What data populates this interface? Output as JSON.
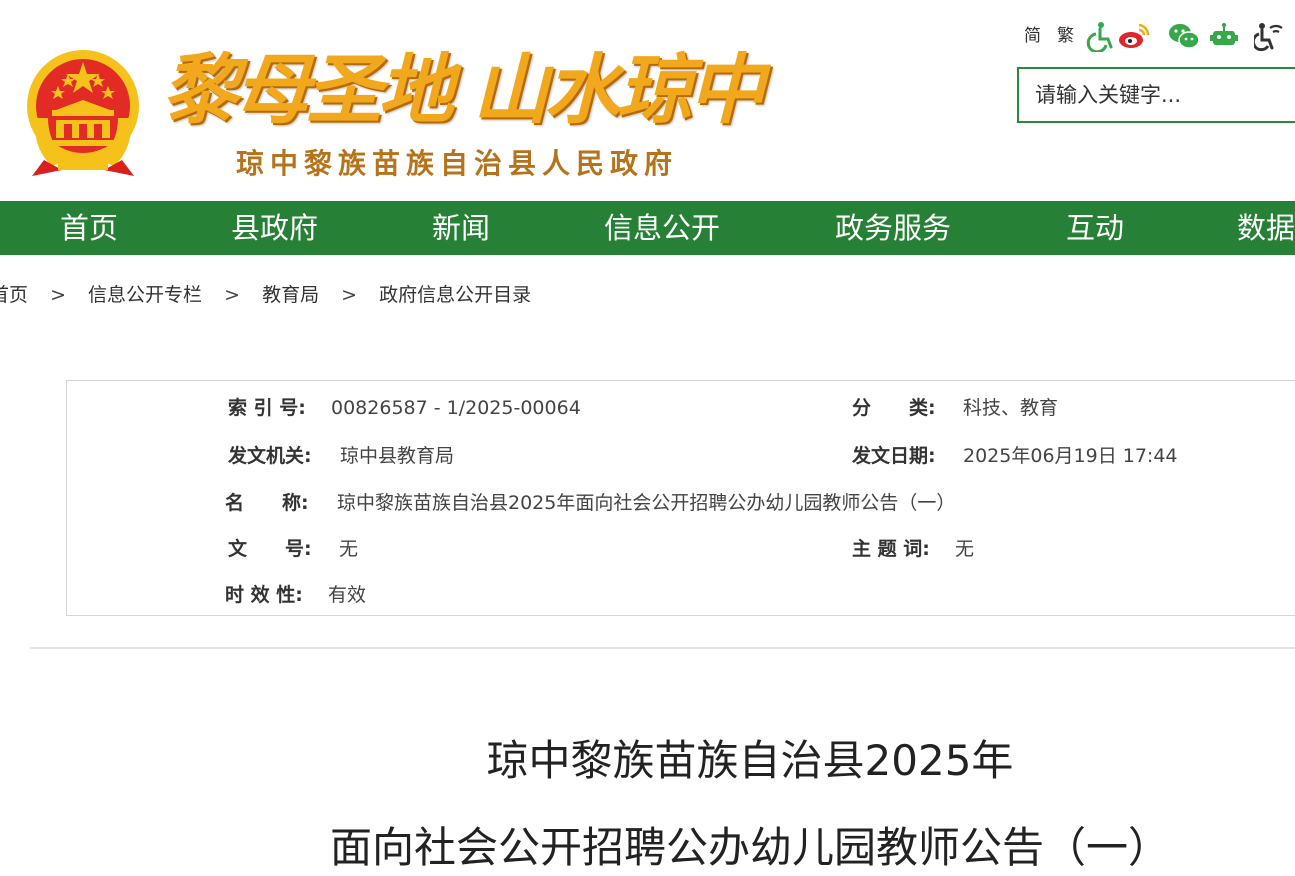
{
  "header": {
    "slogan": "黎母圣地 山水琼中",
    "subtitle": "琼中黎族苗族自治县人民政府"
  },
  "toolbar": {
    "simplified": "简",
    "traditional": "繁",
    "icons": [
      "accessibility-icon",
      "weibo-icon",
      "wechat-icon",
      "robot-icon",
      "elder-mode-icon"
    ],
    "colors": {
      "green": "#36a84a",
      "red": "#e0262b",
      "orange": "#f2a81d"
    }
  },
  "search": {
    "placeholder": "请输入关键字..."
  },
  "nav": {
    "items": [
      {
        "label": "首页"
      },
      {
        "label": "县政府"
      },
      {
        "label": "新闻"
      },
      {
        "label": "信息公开"
      },
      {
        "label": "政务服务"
      },
      {
        "label": "互动"
      },
      {
        "label": "数据"
      }
    ],
    "background": "#268035"
  },
  "breadcrumb": {
    "items": [
      "首页",
      "信息公开专栏",
      "教育局",
      "政府信息公开目录"
    ],
    "separator": ">"
  },
  "info": {
    "index_label": "索 引 号:",
    "index_value": "00826587 - 1/2025-00064",
    "category_label": "分　　类:",
    "category_value": "科技、教育",
    "issuer_label": "发文机关:",
    "issuer_value": "琼中县教育局",
    "date_label": "发文日期:",
    "date_value": "2025年06月19日 17:44",
    "name_label": "名　　称:",
    "name_value": "琼中黎族苗族自治县2025年面向社会公开招聘公办幼儿园教师公告（一）",
    "docno_label": "文　　号:",
    "docno_value": "无",
    "subject_label": "主 题 词:",
    "subject_value": "无",
    "validity_label": "时 效 性:",
    "validity_value": "有效"
  },
  "article": {
    "title_line1": "琼中黎族苗族自治县2025年",
    "title_line2": "面向社会公开招聘公办幼儿园教师公告（一）"
  }
}
